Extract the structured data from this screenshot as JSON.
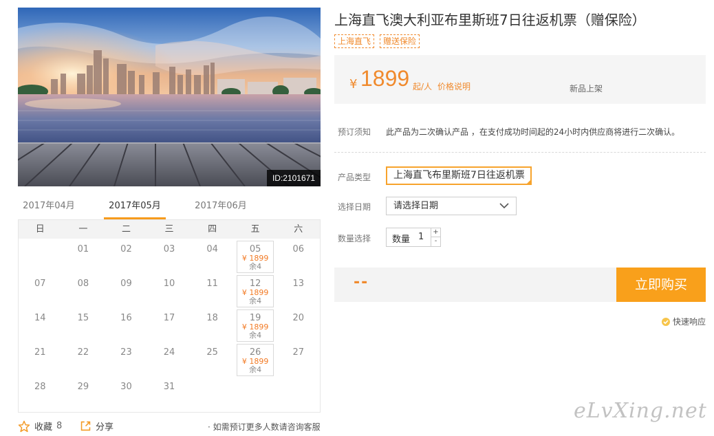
{
  "product": {
    "image_id": "ID:2101671",
    "title": "上海直飞澳大利亚布里斯班7日往返机票（赠保险）",
    "tags": [
      "上海直飞",
      "赠送保险"
    ]
  },
  "price_box": {
    "currency": "¥",
    "price": "1899",
    "unit": "起/人",
    "price_note": "价格说明",
    "status": "新品上架"
  },
  "notice": {
    "label": "预订须知",
    "text": "此产品为二次确认产品 ，在支付成功时间起的24小时内供应商将进行二次确认。"
  },
  "form": {
    "type_label": "产品类型",
    "type_value": "上海直飞布里斯班7日往返机票",
    "date_label": "选择日期",
    "date_value": "请选择日期",
    "qty_section_label": "数量选择",
    "qty_label": "数量",
    "qty_value": "1",
    "plus": "+",
    "minus": "-"
  },
  "buy": {
    "total": "--",
    "button": "立即购买",
    "quick_response": "快速响应"
  },
  "calendar": {
    "months": [
      "2017年04月",
      "2017年05月",
      "2017年06月"
    ],
    "active_month": 1,
    "weekdays": [
      "日",
      "一",
      "二",
      "三",
      "四",
      "五",
      "六"
    ],
    "weeks": [
      [
        {
          "d": ""
        },
        {
          "d": "01"
        },
        {
          "d": "02"
        },
        {
          "d": "03"
        },
        {
          "d": "04"
        },
        {
          "d": "05",
          "price": "¥ 1899",
          "stock": "余4"
        },
        {
          "d": "06"
        }
      ],
      [
        {
          "d": "07"
        },
        {
          "d": "08"
        },
        {
          "d": "09"
        },
        {
          "d": "10"
        },
        {
          "d": "11"
        },
        {
          "d": "12",
          "price": "¥ 1899",
          "stock": "余4"
        },
        {
          "d": "13"
        }
      ],
      [
        {
          "d": "14"
        },
        {
          "d": "15"
        },
        {
          "d": "16"
        },
        {
          "d": "17"
        },
        {
          "d": "18"
        },
        {
          "d": "19",
          "price": "¥ 1899",
          "stock": "余4"
        },
        {
          "d": "20"
        }
      ],
      [
        {
          "d": "21"
        },
        {
          "d": "22"
        },
        {
          "d": "23"
        },
        {
          "d": "24"
        },
        {
          "d": "25"
        },
        {
          "d": "26",
          "price": "¥ 1899",
          "stock": "余4"
        },
        {
          "d": "27"
        }
      ],
      [
        {
          "d": "28"
        },
        {
          "d": "29"
        },
        {
          "d": "30"
        },
        {
          "d": "31"
        },
        {
          "d": ""
        },
        {
          "d": ""
        },
        {
          "d": ""
        }
      ]
    ]
  },
  "actions": {
    "favorite": "收藏",
    "favorite_count": "8",
    "share": "分享",
    "consult": "· 如需预订更多人数请咨询客服"
  },
  "watermark": "eLvXing.net",
  "colors": {
    "accent": "#f9a01b",
    "price": "#f08a2d"
  }
}
